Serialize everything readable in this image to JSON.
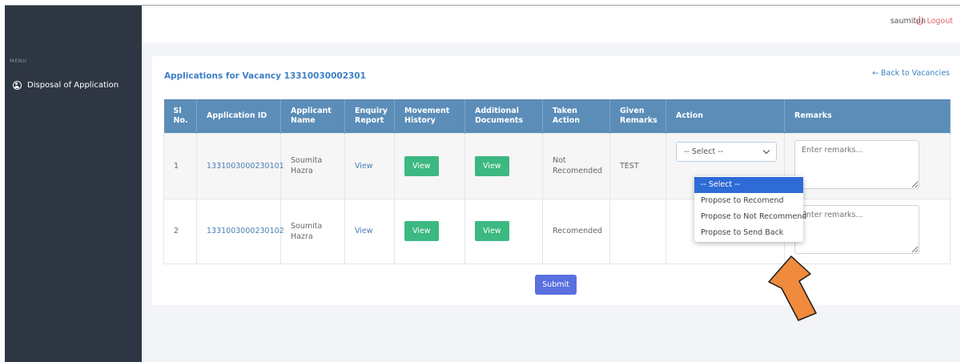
{
  "header": {
    "username": "saumitah",
    "logout_label": "Logout"
  },
  "sidebar": {
    "menu_label": "MENU",
    "items": [
      {
        "label": "Disposal of Application",
        "icon": "user-circle-icon"
      }
    ]
  },
  "page": {
    "title": "Applications for Vacancy 13310030002301",
    "back_link": "← Back to Vacancies"
  },
  "table": {
    "headers": [
      "Sl No.",
      "Application ID",
      "Applicant Name",
      "Enquiry Report",
      "Movement History",
      "Additional Documents",
      "Taken Action",
      "Given Remarks",
      "Action",
      "Remarks"
    ],
    "rows": [
      {
        "sl": "1",
        "app_id": "1331003000230101",
        "name": "Soumita Hazra",
        "enquiry": "View",
        "movement": "View",
        "documents": "View",
        "taken_action": "Not Recomended",
        "given_remarks": "TEST",
        "action_value": "-- Select --",
        "remarks_placeholder": "Enter remarks..."
      },
      {
        "sl": "2",
        "app_id": "1331003000230102",
        "name": "Soumita Hazra",
        "enquiry": "View",
        "movement": "View",
        "documents": "View",
        "taken_action": "Recomended",
        "given_remarks": "",
        "action_value": "",
        "remarks_placeholder": "Enter remarks..."
      }
    ]
  },
  "dropdown": {
    "options": [
      "-- Select --",
      "Propose to Recomend",
      "Propose to Not Recommend",
      "Propose to Send Back"
    ],
    "selected_index": 0
  },
  "submit_label": "Submit",
  "colors": {
    "sidebar": "#2f3643",
    "table_header": "#5b8db8",
    "view_button": "#3cb881",
    "submit": "#5a6fe0",
    "arrow": "#f08a3c",
    "link": "#3d80c7"
  }
}
